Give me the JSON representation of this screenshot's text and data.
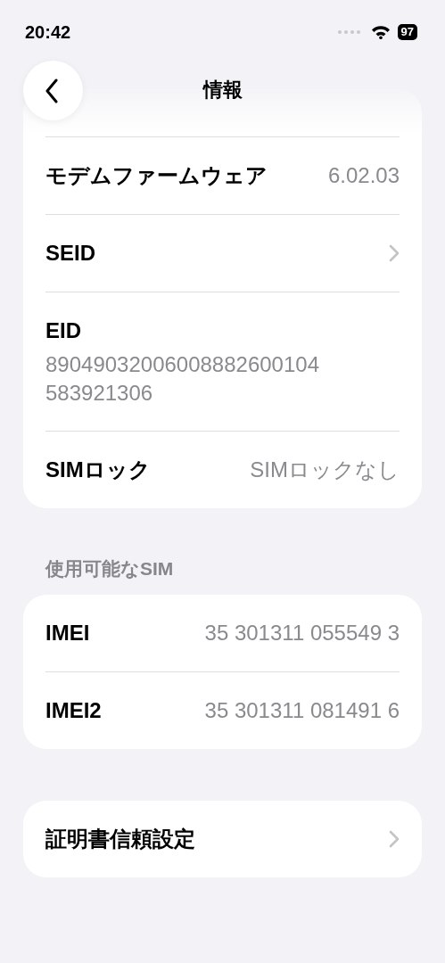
{
  "status_bar": {
    "time": "20:42",
    "battery": "97"
  },
  "nav": {
    "title": "情報"
  },
  "sections": [
    {
      "kind": "scrolled",
      "rows": [
        {
          "kind": "value",
          "label": "モデムファームウェア",
          "value": "6.02.03"
        },
        {
          "kind": "link",
          "label": "SEID"
        },
        {
          "kind": "stacked",
          "label": "EID",
          "value": "89049032006008882600104583921306"
        },
        {
          "kind": "value",
          "label": "SIMロック",
          "value": "SIMロックなし"
        }
      ]
    },
    {
      "header": "使用可能なSIM",
      "rows": [
        {
          "kind": "value",
          "label": "IMEI",
          "value": "35 301311 055549 3"
        },
        {
          "kind": "value",
          "label": "IMEI2",
          "value": "35 301311 081491 6"
        }
      ]
    },
    {
      "rows": [
        {
          "kind": "link",
          "label": "証明書信頼設定"
        }
      ]
    }
  ]
}
